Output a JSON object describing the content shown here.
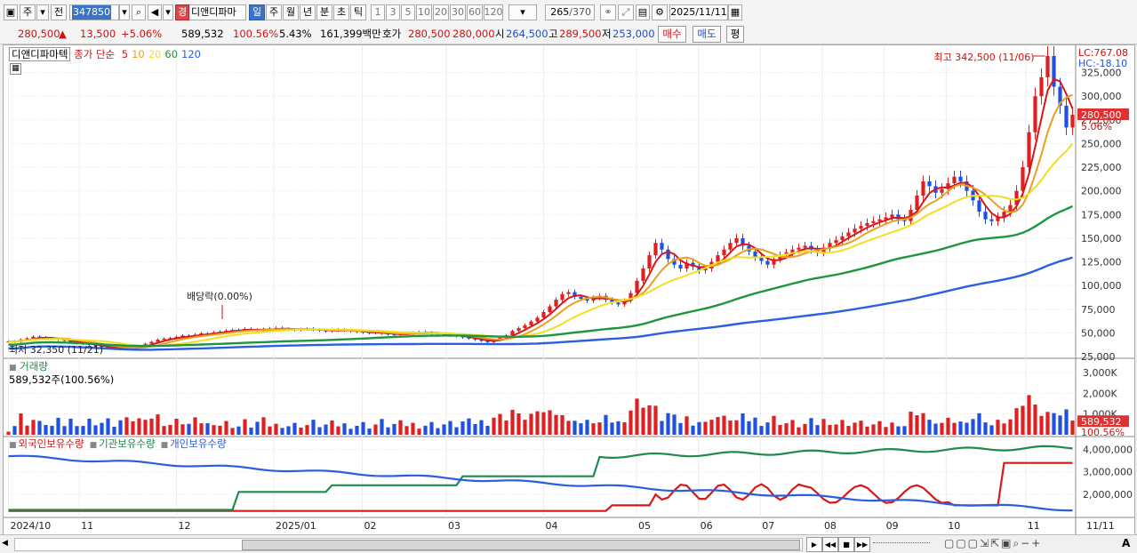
{
  "toolbar": {
    "market_label": "주",
    "prefix_label": "전",
    "stock_code": "347850",
    "stock_name_badge": "경",
    "stock_name": "디앤디파마",
    "period_tabs": [
      "일",
      "주",
      "월",
      "년",
      "분",
      "초",
      "틱"
    ],
    "selected_period": "일",
    "interval_buttons": [
      "1",
      "3",
      "5",
      "10",
      "20",
      "30",
      "60",
      "120"
    ],
    "count_value": "265",
    "count_total": "/370",
    "date_value": "2025/11/11"
  },
  "quote": {
    "price": "280,500",
    "change_arrow": "▲",
    "change": "13,500",
    "change_pct": "+5.06%",
    "volume": "589,532",
    "volume_ratio": "100.56%",
    "turnover": "5.43%",
    "amount": "161,399백만",
    "bid_ask_label": "호가",
    "ask": "280,500",
    "bid": "280,000",
    "open_label": "시",
    "open": "264,500",
    "high_label": "고",
    "high": "289,500",
    "low_label": "저",
    "low": "253,000",
    "buy_button": "매수",
    "sell_button": "매도",
    "eval_button": "평"
  },
  "price_panel": {
    "stock_label": "디앤디파마텍",
    "ma_label": "종가 단순",
    "ma_periods": [
      "5",
      "10",
      "20",
      "60",
      "120"
    ],
    "ma_colors": [
      "#d81818",
      "#e8a020",
      "#f0e020",
      "#1e9640",
      "#2b5fe0"
    ],
    "lc_label": "LC:767.08",
    "hc_label": "HC:-18.10",
    "high_annotation": "최고 342,500 (11/06)",
    "low_annotation": "최저 32,350 (11/21)",
    "event_annotation": "배당락(0.00%)",
    "current_price_tag": "280,500",
    "current_pct_tag": "5.06%",
    "y_ticks": [
      "325,000",
      "300,000",
      "275,000",
      "250,000",
      "225,000",
      "200,000",
      "175,000",
      "150,000",
      "125,000",
      "100,000",
      "75,000",
      "50,000",
      "25,000"
    ]
  },
  "volume_panel": {
    "title": "거래량",
    "value_label": "589,532주(100.56%)",
    "y_ticks": [
      "3,000K",
      "2,000K",
      "1,000K"
    ],
    "current_tag": "589,532",
    "current_pct_tag": "100.56%"
  },
  "holding_panel": {
    "series_labels": [
      "외국인보유수량",
      "기관보유수량",
      "개인보유수량"
    ],
    "series_colors": [
      "#d81818",
      "#1e8a50",
      "#2b5fe0"
    ],
    "y_ticks": [
      "4,000,000",
      "3,000,000",
      "2,000,000"
    ]
  },
  "x_axis": {
    "labels": [
      "2024/10",
      "11",
      "12",
      "2025/01",
      "02",
      "03",
      "04",
      "05",
      "06",
      "07",
      "08",
      "09",
      "10",
      "11"
    ],
    "right_label": "11/11"
  },
  "chart_data": {
    "type": "line",
    "price_ohlc_note": "daily candles",
    "price_close_daily": [
      41000,
      40500,
      43000,
      44200,
      46000,
      45200,
      44000,
      43800,
      42500,
      41800,
      40200,
      39000,
      38500,
      37200,
      36100,
      35200,
      34100,
      33500,
      32350,
      33400,
      34800,
      36200,
      38500,
      40500,
      42800,
      43900,
      44500,
      45800,
      47200,
      46500,
      48000,
      49500,
      48800,
      50500,
      51200,
      52300,
      53100,
      52800,
      54200,
      53500,
      52100,
      53800,
      54600,
      55200,
      54100,
      53500,
      52900,
      53800,
      54500,
      53200,
      52400,
      51800,
      52600,
      53400,
      52700,
      51900,
      51200,
      50400,
      49800,
      50600,
      49200,
      48500,
      47800,
      48600,
      49400,
      50200,
      51000,
      50300,
      49500,
      48800,
      48000,
      47200,
      46500,
      45200,
      44000,
      42800,
      41500,
      40200,
      42500,
      45000,
      47500,
      52000,
      55000,
      58000,
      62000,
      66000,
      72000,
      78000,
      85000,
      91000,
      93000,
      88000,
      86000,
      84000,
      87000,
      89000,
      85000,
      82000,
      80000,
      84000,
      92000,
      105000,
      118000,
      132000,
      145000,
      138000,
      128000,
      122000,
      118000,
      124000,
      120000,
      116000,
      118000,
      125000,
      132000,
      138000,
      145000,
      150000,
      142000,
      136000,
      130000,
      126000,
      122000,
      128000,
      132000,
      135000,
      138000,
      140000,
      142000,
      138000,
      135000,
      140000,
      145000,
      148000,
      152000,
      156000,
      160000,
      163000,
      166000,
      168000,
      170000,
      172000,
      175000,
      170000,
      168000,
      180000,
      195000,
      210000,
      205000,
      198000,
      202000,
      208000,
      215000,
      210000,
      200000,
      190000,
      178000,
      170000,
      168000,
      172000,
      178000,
      185000,
      200000,
      225000,
      262000,
      300000,
      320000,
      342500,
      310000,
      290000,
      267000,
      280500
    ],
    "price_ylim": [
      25000,
      350000
    ],
    "volume_ylim": [
      0,
      3600000
    ],
    "holding_ylim": [
      1000000,
      4500000
    ]
  },
  "bottom_controls": {
    "buttons": [
      "▶",
      "◀◀",
      "■",
      "▶▶"
    ],
    "zoom_label": "A"
  }
}
